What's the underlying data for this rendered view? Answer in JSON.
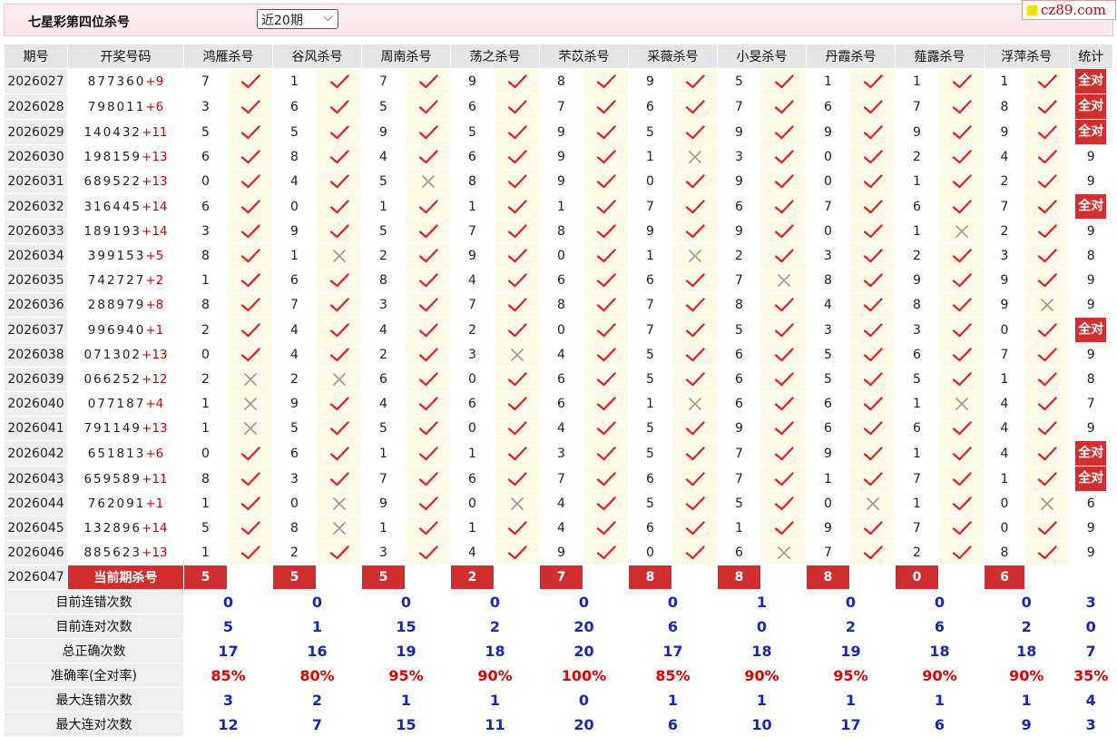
{
  "header": {
    "title": "七星彩第四位杀号",
    "period_select": "近20期",
    "logo_text": "cz89.com"
  },
  "columns": [
    "期号",
    "开奖号码",
    "鸿雁杀号",
    "谷风杀号",
    "周南杀号",
    "荡之杀号",
    "芣苡杀号",
    "采薇杀号",
    "小旻杀号",
    "丹霞杀号",
    "薤露杀号",
    "浮萍杀号",
    "统计"
  ],
  "rows": [
    {
      "period": "2026027",
      "digits": "877360",
      "extra": "+9",
      "kills": [
        7,
        1,
        7,
        9,
        8,
        9,
        5,
        1,
        1,
        1
      ],
      "marks": [
        1,
        1,
        1,
        1,
        1,
        1,
        1,
        1,
        1,
        1
      ],
      "stat": "全对"
    },
    {
      "period": "2026028",
      "digits": "798011",
      "extra": "+6",
      "kills": [
        3,
        6,
        5,
        6,
        7,
        6,
        7,
        6,
        7,
        8
      ],
      "marks": [
        1,
        1,
        1,
        1,
        1,
        1,
        1,
        1,
        1,
        1
      ],
      "stat": "全对"
    },
    {
      "period": "2026029",
      "digits": "140432",
      "extra": "+11",
      "kills": [
        5,
        5,
        9,
        5,
        9,
        5,
        9,
        9,
        9,
        9
      ],
      "marks": [
        1,
        1,
        1,
        1,
        1,
        1,
        1,
        1,
        1,
        1
      ],
      "stat": "全对"
    },
    {
      "period": "2026030",
      "digits": "198159",
      "extra": "+13",
      "kills": [
        6,
        8,
        4,
        6,
        9,
        1,
        3,
        0,
        2,
        4
      ],
      "marks": [
        1,
        1,
        1,
        1,
        1,
        0,
        1,
        1,
        1,
        1
      ],
      "stat": "9"
    },
    {
      "period": "2026031",
      "digits": "689522",
      "extra": "+13",
      "kills": [
        0,
        4,
        5,
        8,
        9,
        0,
        9,
        0,
        1,
        2
      ],
      "marks": [
        1,
        1,
        0,
        1,
        1,
        1,
        1,
        1,
        1,
        1
      ],
      "stat": "9"
    },
    {
      "period": "2026032",
      "digits": "316445",
      "extra": "+14",
      "kills": [
        6,
        0,
        1,
        1,
        1,
        7,
        6,
        7,
        6,
        7
      ],
      "marks": [
        1,
        1,
        1,
        1,
        1,
        1,
        1,
        1,
        1,
        1
      ],
      "stat": "全对"
    },
    {
      "period": "2026033",
      "digits": "189193",
      "extra": "+14",
      "kills": [
        3,
        9,
        5,
        7,
        8,
        9,
        9,
        0,
        1,
        2
      ],
      "marks": [
        1,
        1,
        1,
        1,
        1,
        1,
        1,
        1,
        0,
        1
      ],
      "stat": "9"
    },
    {
      "period": "2026034",
      "digits": "399153",
      "extra": "+5",
      "kills": [
        8,
        1,
        2,
        9,
        0,
        1,
        2,
        3,
        2,
        3
      ],
      "marks": [
        1,
        0,
        1,
        1,
        1,
        0,
        1,
        1,
        1,
        1
      ],
      "stat": "8"
    },
    {
      "period": "2026035",
      "digits": "742727",
      "extra": "+2",
      "kills": [
        1,
        6,
        8,
        4,
        6,
        6,
        7,
        8,
        9,
        9
      ],
      "marks": [
        1,
        1,
        1,
        1,
        1,
        1,
        0,
        1,
        1,
        1
      ],
      "stat": "9"
    },
    {
      "period": "2026036",
      "digits": "288979",
      "extra": "+8",
      "kills": [
        8,
        7,
        3,
        7,
        8,
        7,
        8,
        4,
        8,
        9
      ],
      "marks": [
        1,
        1,
        1,
        1,
        1,
        1,
        1,
        1,
        1,
        0
      ],
      "stat": "9"
    },
    {
      "period": "2026037",
      "digits": "996940",
      "extra": "+1",
      "kills": [
        2,
        4,
        4,
        2,
        0,
        7,
        5,
        3,
        3,
        0
      ],
      "marks": [
        1,
        1,
        1,
        1,
        1,
        1,
        1,
        1,
        1,
        1
      ],
      "stat": "全对"
    },
    {
      "period": "2026038",
      "digits": "071302",
      "extra": "+13",
      "kills": [
        0,
        4,
        2,
        3,
        4,
        5,
        6,
        5,
        6,
        7
      ],
      "marks": [
        1,
        1,
        1,
        0,
        1,
        1,
        1,
        1,
        1,
        1
      ],
      "stat": "9"
    },
    {
      "period": "2026039",
      "digits": "066252",
      "extra": "+12",
      "kills": [
        2,
        2,
        6,
        0,
        6,
        5,
        6,
        5,
        5,
        1
      ],
      "marks": [
        0,
        0,
        1,
        1,
        1,
        1,
        1,
        1,
        1,
        1
      ],
      "stat": "8"
    },
    {
      "period": "2026040",
      "digits": "077187",
      "extra": "+4",
      "kills": [
        1,
        9,
        4,
        6,
        6,
        1,
        6,
        6,
        1,
        4
      ],
      "marks": [
        0,
        1,
        1,
        1,
        1,
        0,
        1,
        1,
        0,
        1
      ],
      "stat": "7"
    },
    {
      "period": "2026041",
      "digits": "791149",
      "extra": "+13",
      "kills": [
        1,
        5,
        5,
        0,
        4,
        5,
        9,
        6,
        6,
        4
      ],
      "marks": [
        0,
        1,
        1,
        1,
        1,
        1,
        1,
        1,
        1,
        1
      ],
      "stat": "9"
    },
    {
      "period": "2026042",
      "digits": "651813",
      "extra": "+6",
      "kills": [
        0,
        6,
        1,
        1,
        3,
        5,
        7,
        9,
        1,
        4
      ],
      "marks": [
        1,
        1,
        1,
        1,
        1,
        1,
        1,
        1,
        1,
        1
      ],
      "stat": "全对"
    },
    {
      "period": "2026043",
      "digits": "659589",
      "extra": "+11",
      "kills": [
        8,
        3,
        7,
        6,
        7,
        6,
        7,
        1,
        7,
        1
      ],
      "marks": [
        1,
        1,
        1,
        1,
        1,
        1,
        1,
        1,
        1,
        1
      ],
      "stat": "全对"
    },
    {
      "period": "2026044",
      "digits": "762091",
      "extra": "+1",
      "kills": [
        1,
        0,
        9,
        0,
        4,
        5,
        5,
        0,
        1,
        0
      ],
      "marks": [
        1,
        0,
        1,
        0,
        1,
        1,
        1,
        0,
        1,
        0
      ],
      "stat": "6"
    },
    {
      "period": "2026045",
      "digits": "132896",
      "extra": "+14",
      "kills": [
        5,
        8,
        1,
        1,
        4,
        6,
        1,
        9,
        7,
        0
      ],
      "marks": [
        1,
        0,
        1,
        1,
        1,
        1,
        1,
        1,
        1,
        1
      ],
      "stat": "9"
    },
    {
      "period": "2026046",
      "digits": "885623",
      "extra": "+13",
      "kills": [
        1,
        2,
        3,
        4,
        9,
        0,
        6,
        7,
        2,
        8
      ],
      "marks": [
        1,
        1,
        1,
        1,
        1,
        1,
        0,
        1,
        1,
        1
      ],
      "stat": "9"
    }
  ],
  "current": {
    "period": "2026047",
    "label": "当前期杀号",
    "kills": [
      5,
      5,
      5,
      2,
      7,
      8,
      8,
      8,
      0,
      6
    ]
  },
  "summary": [
    {
      "label": "目前连错次数",
      "values": [
        "0",
        "0",
        "0",
        "0",
        "0",
        "0",
        "1",
        "0",
        "0",
        "0"
      ],
      "stat": "3",
      "red": false
    },
    {
      "label": "目前连对次数",
      "values": [
        "5",
        "1",
        "15",
        "2",
        "20",
        "6",
        "0",
        "2",
        "6",
        "2"
      ],
      "stat": "0",
      "red": false
    },
    {
      "label": "总正确次数",
      "values": [
        "17",
        "16",
        "19",
        "18",
        "20",
        "17",
        "18",
        "19",
        "18",
        "18"
      ],
      "stat": "7",
      "red": false
    },
    {
      "label": "准确率(全对率)",
      "values": [
        "85%",
        "80%",
        "95%",
        "90%",
        "100%",
        "85%",
        "90%",
        "95%",
        "90%",
        "90%"
      ],
      "stat": "35%",
      "red": true
    },
    {
      "label": "最大连错次数",
      "values": [
        "3",
        "2",
        "1",
        "1",
        "0",
        "1",
        "1",
        "1",
        "1",
        "1"
      ],
      "stat": "4",
      "red": false
    },
    {
      "label": "最大连对次数",
      "values": [
        "12",
        "7",
        "15",
        "11",
        "20",
        "6",
        "10",
        "17",
        "6",
        "9"
      ],
      "stat": "3",
      "red": false
    }
  ],
  "icons": {
    "correct": "check-icon",
    "wrong": "cross-icon"
  },
  "colors": {
    "accent_red": "#d12f2f",
    "summary_blue": "#1628b5",
    "check_red": "#e0202a",
    "cross_gray": "#9a9a9a"
  }
}
